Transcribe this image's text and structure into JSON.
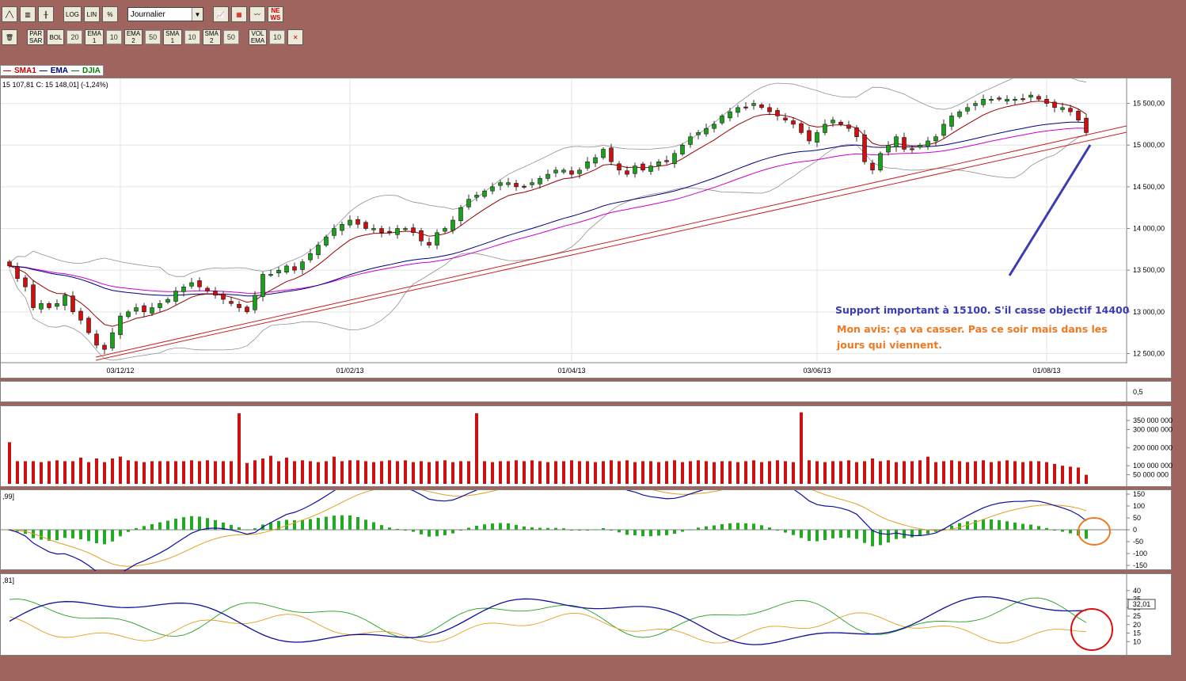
{
  "toolbar1": {
    "buttons": [
      "╱╲",
      "▥",
      "╫",
      "LOG",
      "LIN",
      "%"
    ],
    "period_select": "Journalier",
    "icon_buttons": [
      "chart-type-icon",
      "colors-icon",
      "compare-icon",
      "news-icon"
    ],
    "news_label": "NE\nWS"
  },
  "toolbar2": {
    "items": [
      {
        "label": "PAR\nSAR",
        "value": ""
      },
      {
        "label": "BOL",
        "value": "20"
      },
      {
        "label": "EMA\n1",
        "value": "10"
      },
      {
        "label": "EMA\n2",
        "value": "50"
      },
      {
        "label": "SMA\n1",
        "value": "10"
      },
      {
        "label": "SMA\n2",
        "value": "50"
      },
      {
        "label": "VOL\nEMA",
        "value": "10"
      }
    ]
  },
  "legend": {
    "sma": "SMA1",
    "ema": "EMA",
    "djia": "DJIA",
    "colors": {
      "sma": "#cc0000",
      "ema": "#000080",
      "djia": "#008000"
    }
  },
  "price_panel": {
    "info": "15 107,81  C: 15 148,01] (-1,24%)",
    "ylabels": [
      "15 500,00",
      "15 000,00",
      "14 500,00",
      "14 000,00",
      "13 500,00",
      "13 000,00",
      "12 500,00"
    ],
    "xlabels": [
      "03/12/12",
      "01/02/13",
      "01/04/13",
      "03/06/13",
      "01/08/13"
    ]
  },
  "small_panel": {
    "ylabel": "0,5"
  },
  "volume_panel": {
    "ylabels": [
      "350 000 000",
      "300 000 000",
      "200 000 000",
      "100 000 000",
      "50 000 000"
    ]
  },
  "macd_panel": {
    "info": ",99]",
    "ylabels": [
      "150",
      "100",
      "50",
      "0",
      "-50",
      "-100",
      "-150"
    ]
  },
  "stoch_panel": {
    "info": ",81]",
    "ylabels": [
      "40",
      "35",
      "30",
      "25",
      "20",
      "15",
      "10"
    ],
    "current_value": "32,01"
  },
  "annotations": {
    "support": "Support important à 15100. S'il casse objectif 14400",
    "avis_line1": "Mon avis: ça va casser. Pas ce soir mais dans les",
    "avis_line2": "jours qui viennent.",
    "support_color": "#3c3cb4",
    "avis_color": "#f07820"
  },
  "chart_data": {
    "type": "candlestick",
    "ylim": [
      12400,
      15800
    ],
    "x_ticks": [
      "03/12/12",
      "01/02/13",
      "01/04/13",
      "03/06/13",
      "01/08/13"
    ],
    "closes": [
      13550,
      13400,
      13300,
      13050,
      13100,
      13050,
      13100,
      13200,
      13000,
      12900,
      12750,
      12600,
      12550,
      12750,
      12950,
      13000,
      13050,
      13000,
      13050,
      13100,
      13150,
      13250,
      13300,
      13350,
      13300,
      13250,
      13200,
      13150,
      13100,
      13050,
      13000,
      13200,
      13450,
      13450,
      13500,
      13550,
      13500,
      13600,
      13700,
      13800,
      13900,
      14000,
      14050,
      14100,
      14050,
      14000,
      14000,
      13950,
      13950,
      14000,
      14000,
      13950,
      13850,
      13800,
      13950,
      14000,
      14100,
      14250,
      14350,
      14400,
      14450,
      14500,
      14550,
      14550,
      14500,
      14500,
      14550,
      14600,
      14650,
      14700,
      14700,
      14650,
      14700,
      14800,
      14850,
      14950,
      14800,
      14700,
      14650,
      14750,
      14700,
      14750,
      14800,
      14800,
      14900,
      15000,
      15100,
      15150,
      15200,
      15250,
      15350,
      15400,
      15450,
      15450,
      15500,
      15450,
      15400,
      15350,
      15300,
      15250,
      15150,
      15050,
      15150,
      15250,
      15300,
      15250,
      15200,
      15100,
      14800,
      14700,
      14900,
      15000,
      15100,
      14950,
      14950,
      15000,
      15050,
      15100,
      15250,
      15350,
      15400,
      15450,
      15500,
      15550,
      15550,
      15550,
      15550,
      15550,
      15550,
      15600,
      15550,
      15500,
      15450,
      15450,
      15400,
      15300,
      15150
    ],
    "volume": [
      230,
      125,
      125,
      125,
      120,
      125,
      130,
      125,
      125,
      145,
      120,
      140,
      120,
      140,
      150,
      130,
      125,
      120,
      125,
      125,
      125,
      125,
      125,
      130,
      125,
      130,
      125,
      125,
      125,
      390,
      115,
      130,
      140,
      155,
      125,
      145,
      125,
      130,
      125,
      120,
      125,
      150,
      125,
      130,
      130,
      125,
      120,
      125,
      130,
      125,
      130,
      120,
      125,
      120,
      125,
      130,
      120,
      125,
      125,
      390,
      125,
      120,
      125,
      125,
      130,
      125,
      130,
      125,
      120,
      125,
      125,
      130,
      125,
      125,
      120,
      125,
      130,
      125,
      130,
      120,
      125,
      125,
      120,
      125,
      130,
      120,
      125,
      130,
      125,
      120,
      125,
      125,
      120,
      125,
      130,
      120,
      125,
      130,
      125,
      120,
      395,
      130,
      125,
      120,
      125,
      125,
      130,
      120,
      125,
      140,
      125,
      130,
      120,
      125,
      125,
      130,
      150,
      120,
      125,
      130,
      125,
      120,
      125,
      130,
      120,
      125,
      130,
      125,
      120,
      125,
      125,
      120,
      110,
      100,
      95,
      90,
      50
    ],
    "support_level": 15100,
    "target_level": 14400
  }
}
